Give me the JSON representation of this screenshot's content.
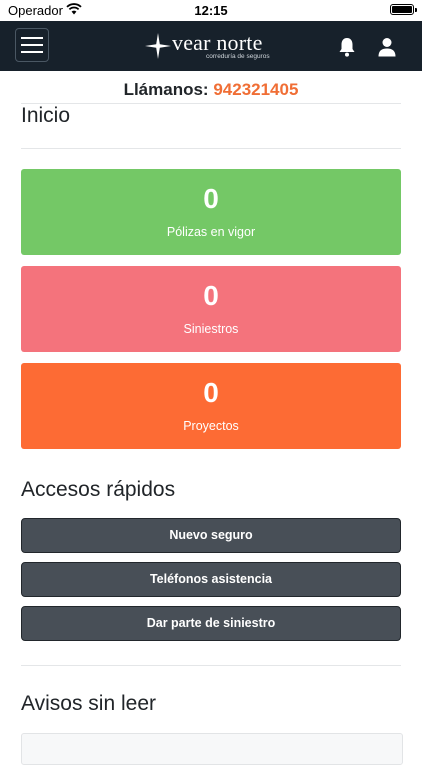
{
  "status_bar": {
    "carrier": "Operador",
    "time": "12:15"
  },
  "navbar": {
    "logo_name": "vear norte",
    "logo_tagline": "correduría de seguros",
    "icons": {
      "menu": "hamburger-menu-icon",
      "bell": "bell-icon",
      "user": "user-icon",
      "logo": "star-logo-icon"
    }
  },
  "contact": {
    "label": "Llámanos:",
    "phone": "942321405",
    "phone_color": "#f06e35"
  },
  "home": {
    "title": "Inicio",
    "stats": [
      {
        "value": "0",
        "label": "Pólizas en vigor",
        "color": "#74c866"
      },
      {
        "value": "0",
        "label": "Siniestros",
        "color": "#f4737c"
      },
      {
        "value": "0",
        "label": "Proyectos",
        "color": "#fd6b34"
      }
    ]
  },
  "quick_access": {
    "title": "Accesos rápidos",
    "buttons": [
      "Nuevo seguro",
      "Teléfonos asistencia",
      "Dar parte de siniestro"
    ]
  },
  "notices": {
    "title": "Avisos sin leer"
  },
  "colors": {
    "navbar_bg": "#17212b",
    "button_bg": "#484f57"
  }
}
